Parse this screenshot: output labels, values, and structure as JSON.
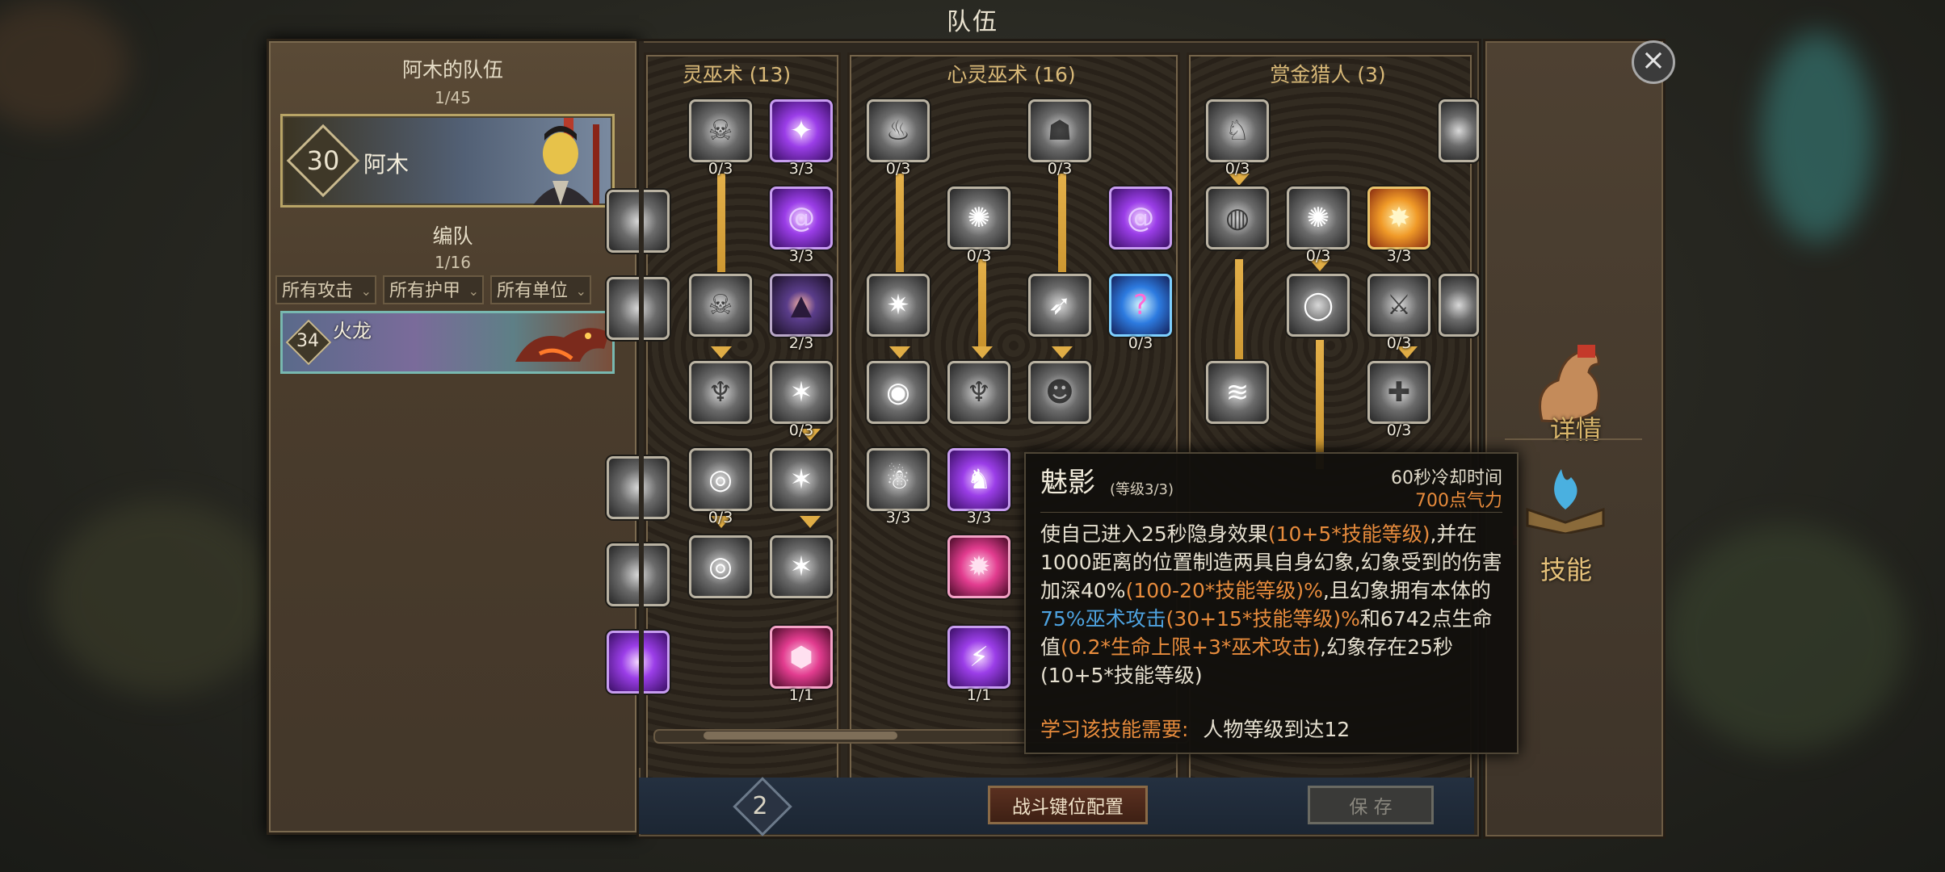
{
  "window_title": "队伍",
  "team": {
    "title": "阿木的队伍",
    "count": "1/45",
    "hero": {
      "level": "30",
      "name": "阿木"
    }
  },
  "formation": {
    "title": "编队",
    "count": "1/16",
    "filters": [
      "所有攻击",
      "所有护甲",
      "所有单位"
    ],
    "unit": {
      "level": "34",
      "name": "火龙"
    }
  },
  "columns": [
    {
      "title": "灵巫术 (13)"
    },
    {
      "title": "心灵巫术 (16)"
    },
    {
      "title": "赏金猎人 (3)"
    }
  ],
  "skills": {
    "c0": [
      "0/3",
      "3/3",
      "3/3",
      "2/3",
      "0/3",
      "0/3",
      "1/1"
    ],
    "c1": [
      "0/3",
      "0/3",
      "0/3",
      "0/3",
      "3/3",
      "3/3",
      "1/1"
    ],
    "c2": [
      "0/3",
      "0/3",
      "3/3",
      "0/3",
      "0/3"
    ]
  },
  "bottom": {
    "page": "2",
    "keybind_button": "战斗键位配置",
    "save_button": "保 存"
  },
  "tabs": {
    "details": "详情",
    "skills": "技能",
    "alert": "!"
  },
  "tooltip": {
    "name": "魅影",
    "level": "(等级3/3)",
    "cooldown": "60秒冷却时间",
    "cost": "700点气力",
    "desc": [
      {
        "t": "使自己进入25秒隐身效果",
        "c": ""
      },
      {
        "t": "(10+5*技能等级)",
        "c": "or"
      },
      {
        "t": ",并在1000距离的位置制造两具自身幻象,幻象受到的伤害加深40%",
        "c": ""
      },
      {
        "t": "(100-20*技能等级)%",
        "c": "or"
      },
      {
        "t": ",且幻象拥有本体的",
        "c": ""
      },
      {
        "t": "75%巫术攻击",
        "c": "bl"
      },
      {
        "t": "(30+15*技能等级)%",
        "c": "or"
      },
      {
        "t": "和6742点生命值",
        "c": ""
      },
      {
        "t": "(0.2*生命上限+3*巫术攻击)",
        "c": "or"
      },
      {
        "t": ",幻象存在25秒(10+5*技能等级)",
        "c": ""
      }
    ],
    "req_label": "学习该技能需要:",
    "req_value": "人物等级到达12"
  },
  "colors": {
    "accent_gold": "#e0ad45",
    "orange_text": "#e78b3c",
    "blue_text": "#4ea3e0"
  }
}
